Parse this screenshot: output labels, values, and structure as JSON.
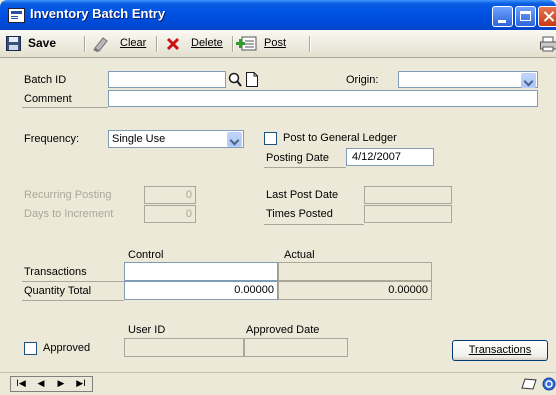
{
  "window": {
    "title": "Inventory Batch Entry"
  },
  "toolbar": {
    "save_label": "Save",
    "clear_label": "Clear",
    "delete_label": "Delete",
    "post_label": "Post"
  },
  "form": {
    "batch_id_label": "Batch ID",
    "batch_id_value": "",
    "origin_label": "Origin:",
    "origin_value": "",
    "comment_label": "Comment",
    "comment_value": "",
    "frequency_label": "Frequency:",
    "frequency_value": "Single Use",
    "post_gl_label": "Post to General Ledger",
    "post_gl_checked": false,
    "posting_date_label": "Posting Date",
    "posting_date_value": "4/12/2007",
    "recurring_posting_label": "Recurring Posting",
    "recurring_posting_value": "0",
    "days_increment_label": "Days to Increment",
    "days_increment_value": "0",
    "last_post_date_label": "Last Post Date",
    "last_post_date_value": "",
    "times_posted_label": "Times Posted",
    "times_posted_value": ""
  },
  "totals": {
    "control_header": "Control",
    "actual_header": "Actual",
    "transactions_label": "Transactions",
    "transactions_control": "",
    "transactions_actual": "",
    "quantity_label": "Quantity Total",
    "quantity_control": "0.00000",
    "quantity_actual": "0.00000"
  },
  "approval": {
    "user_id_header": "User ID",
    "approved_date_header": "Approved Date",
    "approved_label": "Approved",
    "approved_checked": false,
    "user_id_value": "",
    "approved_date_value": "",
    "transactions_button": "Transactions"
  },
  "statusbar": {
    "nav_first": "I◀",
    "nav_prev": "◀",
    "nav_next": "▶",
    "nav_last": "▶I"
  },
  "icons": {
    "window": "window-form-icon",
    "save": "floppy-disk-icon",
    "clear": "eraser-icon",
    "delete": "red-x-icon",
    "post": "post-document-icon",
    "print": "printer-icon",
    "lookup": "magnifier-icon",
    "new": "new-document-icon",
    "note": "note-icon",
    "help": "help-icon"
  },
  "colors": {
    "title_bar": "#0053e5",
    "window_bg": "#ece9d8",
    "field_border": "#7f9db9",
    "delete_red": "#cc1111",
    "post_green": "#2e9e2e"
  }
}
